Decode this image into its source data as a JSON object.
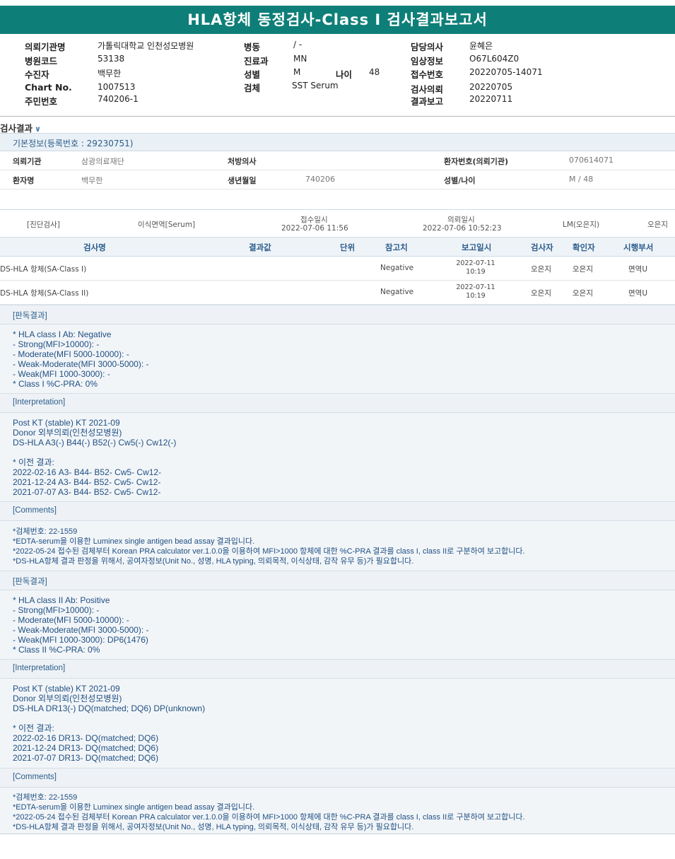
{
  "title": "HLA항체 동정검사-Class I 검사결과보고서",
  "info": {
    "col1": [
      {
        "label": "의뢰기관명",
        "value": "가톨릭대학교 인천성모병원"
      },
      {
        "label": "병원코드",
        "value": "53138"
      },
      {
        "label": "수진자",
        "value": "백무한"
      },
      {
        "label": "Chart No.",
        "value": "1007513"
      },
      {
        "label": "주민번호",
        "value": "740206-1"
      }
    ],
    "col2": [
      {
        "label": "병동",
        "value": "/ -"
      },
      {
        "label": "진료과",
        "value": "MN"
      },
      {
        "label": "성별",
        "value": "M"
      },
      {
        "label": "검체",
        "value": "SST Serum"
      }
    ],
    "age": {
      "label": "나이",
      "value": "48"
    },
    "col3": [
      {
        "label": "담당의사",
        "value": "윤혜은"
      },
      {
        "label": "임상정보",
        "value": "O67L604Z0"
      },
      {
        "label": "접수번호",
        "value": "20220705-14071"
      },
      {
        "label": "검사의뢰",
        "value": "20220705"
      },
      {
        "label": "결과보고",
        "value": "20220711"
      }
    ]
  },
  "section_title": "검사결과",
  "section_chevron": "∨",
  "basic": {
    "header": "기본정보(등록번호 : 29230751)",
    "row1": {
      "l1": "의뢰기관",
      "v1": "삼광의료재단",
      "l2": "처방의사",
      "v2": "",
      "l3": "환자번호(의뢰기관)",
      "v3": "070614071"
    },
    "row2": {
      "l1": "환자명",
      "v1": "백무한",
      "l2": "생년월일",
      "v2": "740206",
      "l3": "성별/나이",
      "v3": "M / 48"
    }
  },
  "order": {
    "type": "[진단검사]",
    "specimen": "이식면역[Serum]",
    "received_label": "접수일시",
    "received": "2022-07-06 11:56",
    "requested_label": "의뢰일시",
    "requested": "2022-07-06 10:52:23",
    "lm": "LM(오은지)",
    "person": "오은지"
  },
  "results_header": {
    "name": "검사명",
    "value": "결과값",
    "unit": "단위",
    "ref": "참고치",
    "report_date": "보고일시",
    "tester": "검사자",
    "confirmer": "확인자",
    "dept": "시행부서"
  },
  "results": [
    {
      "name": "DS-HLA 항체(SA-Class I)",
      "ref": "Negative",
      "date": "2022-07-11",
      "time": "10:19",
      "tester": "오은지",
      "confirmer": "오은지",
      "dept": "면역U"
    },
    {
      "name": "DS-HLA 항체(SA-Class II)",
      "ref": "Negative",
      "date": "2022-07-11",
      "time": "10:19",
      "tester": "오은지",
      "confirmer": "오은지",
      "dept": "면역U"
    }
  ],
  "blocks": [
    {
      "head": "[판독결과]",
      "body": "* HLA class I Ab: Negative\n- Strong(MFI>10000): -\n- Moderate(MFI 5000-10000): -\n- Weak-Moderate(MFI 3000-5000): -\n- Weak(MFI 1000-3000): -\n* Class I %C-PRA: 0%"
    },
    {
      "head": "[Interpretation]",
      "body": "Post KT (stable) KT 2021-09\nDonor 외부의뢰(인천성모병원)\nDS-HLA A3(-) B44(-) B52(-) Cw5(-) Cw12(-)\n\n* 이전 결과:\n2022-02-16 A3- B44- B52- Cw5- Cw12-\n2021-12-24 A3- B44- B52- Cw5- Cw12-\n2021-07-07 A3- B44- B52- Cw5- Cw12-"
    },
    {
      "head": "[Comments]",
      "body": "*검체번호: 22-1559\n*EDTA-serum을 이용한 Luminex single antigen bead assay 결과입니다.\n*2022-05-24 접수된 검체부터 Korean PRA calculator ver.1.0.0을 이용하여 MFI>1000 항체에 대한 %C-PRA 결과를 class I, class II로 구분하여 보고합니다.\n*DS-HLA항체 결과 판정을 위해서, 공여자정보(Unit No., 성명, HLA typing, 의뢰목적, 이식상태, 감작 유무 등)가 필요합니다."
    },
    {
      "head": "[판독결과]",
      "body": "* HLA class II Ab: Positive\n- Strong(MFI>10000): -\n- Moderate(MFI 5000-10000): -\n- Weak-Moderate(MFI 3000-5000): -\n- Weak(MFI 1000-3000): DP6(1476)\n* Class II %C-PRA: 0%"
    },
    {
      "head": "[Interpretation]",
      "body": "Post KT (stable) KT 2021-09\nDonor 외부의뢰(인천성모병원)\nDS-HLA DR13(-) DQ(matched; DQ6) DP(unknown)\n\n* 이전 결과:\n2022-02-16 DR13- DQ(matched; DQ6)\n2021-12-24 DR13- DQ(matched; DQ6)\n2021-07-07 DR13- DQ(matched; DQ6)"
    },
    {
      "head": "[Comments]",
      "body": "*검체번호: 22-1559\n*EDTA-serum을 이용한 Luminex single antigen bead assay 결과입니다.\n*2022-05-24 접수된 검체부터 Korean PRA calculator ver.1.0.0을 이용하여 MFI>1000 항체에 대한 %C-PRA 결과를 class I, class II로 구분하여 보고합니다.\n*DS-HLA항체 결과 판정을 위해서, 공여자정보(Unit No., 성명, HLA typing, 의뢰목적, 이식상태, 감작 유무 등)가 필요합니다."
    }
  ]
}
